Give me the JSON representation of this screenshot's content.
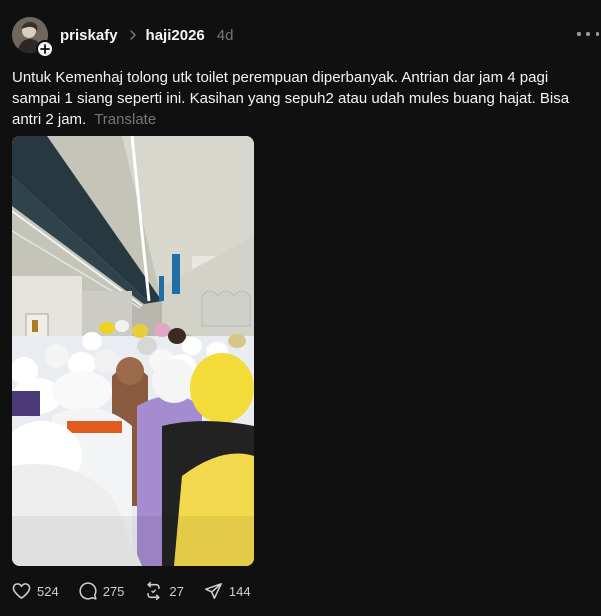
{
  "post": {
    "username": "priskafy",
    "community": "haji2026",
    "timestamp": "4d",
    "text": "Untuk Kemenhaj tolong utk toilet perempuan diperbanyak. Antrian dar jam 4 pagi sampai 1 siang seperti ini. Kasihan yang sepuh2 atau udah mules buang hajat. Bisa antri 2 jam.",
    "translate_label": "Translate",
    "image_icon": "queue-photo",
    "actions": {
      "likes": "524",
      "replies": "275",
      "reposts": "27",
      "shares": "144"
    }
  },
  "icons": {
    "avatar": "profile-photo",
    "follow": "plus-icon",
    "chevron": "chevron-right-icon",
    "more": "more-horizontal-icon",
    "like": "heart-icon",
    "reply": "comment-icon",
    "repost": "repost-icon",
    "share": "send-icon"
  },
  "colors": {
    "background": "#101010",
    "text": "#f3f5f7",
    "muted": "#777777"
  }
}
